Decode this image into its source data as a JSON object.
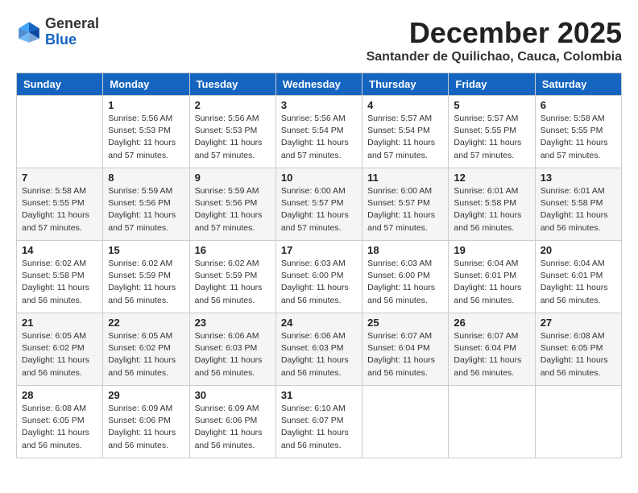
{
  "logo": {
    "line1": "General",
    "line2": "Blue"
  },
  "title": "December 2025",
  "subtitle": "Santander de Quilichao, Cauca, Colombia",
  "headers": [
    "Sunday",
    "Monday",
    "Tuesday",
    "Wednesday",
    "Thursday",
    "Friday",
    "Saturday"
  ],
  "weeks": [
    [
      {
        "day": "",
        "info": ""
      },
      {
        "day": "1",
        "info": "Sunrise: 5:56 AM\nSunset: 5:53 PM\nDaylight: 11 hours\nand 57 minutes."
      },
      {
        "day": "2",
        "info": "Sunrise: 5:56 AM\nSunset: 5:53 PM\nDaylight: 11 hours\nand 57 minutes."
      },
      {
        "day": "3",
        "info": "Sunrise: 5:56 AM\nSunset: 5:54 PM\nDaylight: 11 hours\nand 57 minutes."
      },
      {
        "day": "4",
        "info": "Sunrise: 5:57 AM\nSunset: 5:54 PM\nDaylight: 11 hours\nand 57 minutes."
      },
      {
        "day": "5",
        "info": "Sunrise: 5:57 AM\nSunset: 5:55 PM\nDaylight: 11 hours\nand 57 minutes."
      },
      {
        "day": "6",
        "info": "Sunrise: 5:58 AM\nSunset: 5:55 PM\nDaylight: 11 hours\nand 57 minutes."
      }
    ],
    [
      {
        "day": "7",
        "info": "Sunrise: 5:58 AM\nSunset: 5:55 PM\nDaylight: 11 hours\nand 57 minutes."
      },
      {
        "day": "8",
        "info": "Sunrise: 5:59 AM\nSunset: 5:56 PM\nDaylight: 11 hours\nand 57 minutes."
      },
      {
        "day": "9",
        "info": "Sunrise: 5:59 AM\nSunset: 5:56 PM\nDaylight: 11 hours\nand 57 minutes."
      },
      {
        "day": "10",
        "info": "Sunrise: 6:00 AM\nSunset: 5:57 PM\nDaylight: 11 hours\nand 57 minutes."
      },
      {
        "day": "11",
        "info": "Sunrise: 6:00 AM\nSunset: 5:57 PM\nDaylight: 11 hours\nand 57 minutes."
      },
      {
        "day": "12",
        "info": "Sunrise: 6:01 AM\nSunset: 5:58 PM\nDaylight: 11 hours\nand 56 minutes."
      },
      {
        "day": "13",
        "info": "Sunrise: 6:01 AM\nSunset: 5:58 PM\nDaylight: 11 hours\nand 56 minutes."
      }
    ],
    [
      {
        "day": "14",
        "info": "Sunrise: 6:02 AM\nSunset: 5:58 PM\nDaylight: 11 hours\nand 56 minutes."
      },
      {
        "day": "15",
        "info": "Sunrise: 6:02 AM\nSunset: 5:59 PM\nDaylight: 11 hours\nand 56 minutes."
      },
      {
        "day": "16",
        "info": "Sunrise: 6:02 AM\nSunset: 5:59 PM\nDaylight: 11 hours\nand 56 minutes."
      },
      {
        "day": "17",
        "info": "Sunrise: 6:03 AM\nSunset: 6:00 PM\nDaylight: 11 hours\nand 56 minutes."
      },
      {
        "day": "18",
        "info": "Sunrise: 6:03 AM\nSunset: 6:00 PM\nDaylight: 11 hours\nand 56 minutes."
      },
      {
        "day": "19",
        "info": "Sunrise: 6:04 AM\nSunset: 6:01 PM\nDaylight: 11 hours\nand 56 minutes."
      },
      {
        "day": "20",
        "info": "Sunrise: 6:04 AM\nSunset: 6:01 PM\nDaylight: 11 hours\nand 56 minutes."
      }
    ],
    [
      {
        "day": "21",
        "info": "Sunrise: 6:05 AM\nSunset: 6:02 PM\nDaylight: 11 hours\nand 56 minutes."
      },
      {
        "day": "22",
        "info": "Sunrise: 6:05 AM\nSunset: 6:02 PM\nDaylight: 11 hours\nand 56 minutes."
      },
      {
        "day": "23",
        "info": "Sunrise: 6:06 AM\nSunset: 6:03 PM\nDaylight: 11 hours\nand 56 minutes."
      },
      {
        "day": "24",
        "info": "Sunrise: 6:06 AM\nSunset: 6:03 PM\nDaylight: 11 hours\nand 56 minutes."
      },
      {
        "day": "25",
        "info": "Sunrise: 6:07 AM\nSunset: 6:04 PM\nDaylight: 11 hours\nand 56 minutes."
      },
      {
        "day": "26",
        "info": "Sunrise: 6:07 AM\nSunset: 6:04 PM\nDaylight: 11 hours\nand 56 minutes."
      },
      {
        "day": "27",
        "info": "Sunrise: 6:08 AM\nSunset: 6:05 PM\nDaylight: 11 hours\nand 56 minutes."
      }
    ],
    [
      {
        "day": "28",
        "info": "Sunrise: 6:08 AM\nSunset: 6:05 PM\nDaylight: 11 hours\nand 56 minutes."
      },
      {
        "day": "29",
        "info": "Sunrise: 6:09 AM\nSunset: 6:06 PM\nDaylight: 11 hours\nand 56 minutes."
      },
      {
        "day": "30",
        "info": "Sunrise: 6:09 AM\nSunset: 6:06 PM\nDaylight: 11 hours\nand 56 minutes."
      },
      {
        "day": "31",
        "info": "Sunrise: 6:10 AM\nSunset: 6:07 PM\nDaylight: 11 hours\nand 56 minutes."
      },
      {
        "day": "",
        "info": ""
      },
      {
        "day": "",
        "info": ""
      },
      {
        "day": "",
        "info": ""
      }
    ]
  ]
}
